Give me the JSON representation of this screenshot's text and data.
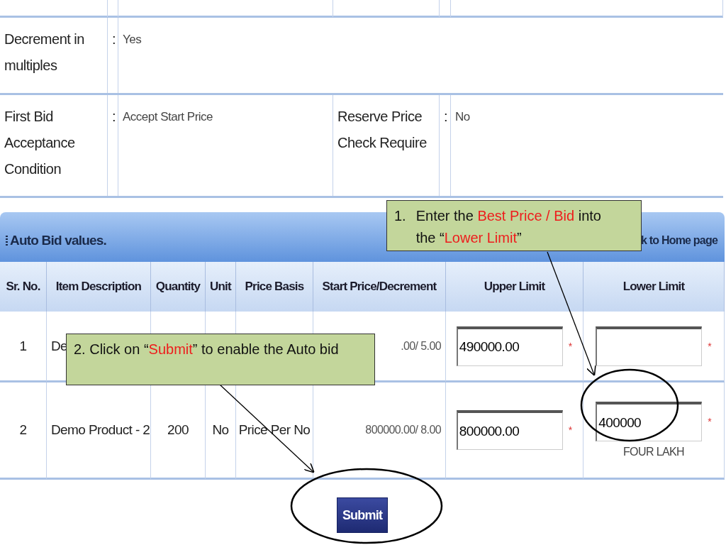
{
  "info_rows": [
    {
      "label": "Decrement in multiples",
      "value": "Yes"
    },
    {
      "label": "First Bid Acceptance Condition",
      "value": "Accept Start Price",
      "label_2": "Reserve Price Check Require",
      "value_2": "No"
    }
  ],
  "separator": ":",
  "auto_bid": {
    "title": "Auto Bid values.",
    "home_link": "k to Home page",
    "columns": [
      "Sr. No.",
      "Item Description",
      "Quantity",
      "Unit",
      "Price Basis",
      "Start Price/Decrement",
      "Upper Limit",
      "Lower Limit"
    ],
    "rows": [
      {
        "sr": "1",
        "description": "De",
        "start_price": ".00/ 5.00",
        "upper": "490000.00",
        "required_mark": "*"
      },
      {
        "sr": "2",
        "description": "Demo Product - 2",
        "quantity": "200",
        "unit": "No",
        "price_basis": "Price Per No",
        "start_price": "800000.00/ 8.00",
        "upper": "800000.00",
        "lower": "400000",
        "lower_words": "FOUR LAKH",
        "required_mark": "*"
      }
    ],
    "submit": "Submit"
  },
  "callouts": [
    {
      "number": "1.",
      "parts": [
        {
          "text": "Enter the ",
          "highlight": false
        },
        {
          "text": "Best Price / Bid",
          "highlight": true
        },
        {
          "text": " into the “",
          "highlight": false
        },
        {
          "text": "Lower Limit",
          "highlight": true
        },
        {
          "text": "”",
          "highlight": false
        }
      ]
    },
    {
      "parts": [
        {
          "text": "2. Click on “",
          "highlight": false
        },
        {
          "text": "Submit",
          "highlight": true
        },
        {
          "text": "” to enable the Auto bid",
          "highlight": false
        }
      ]
    }
  ]
}
